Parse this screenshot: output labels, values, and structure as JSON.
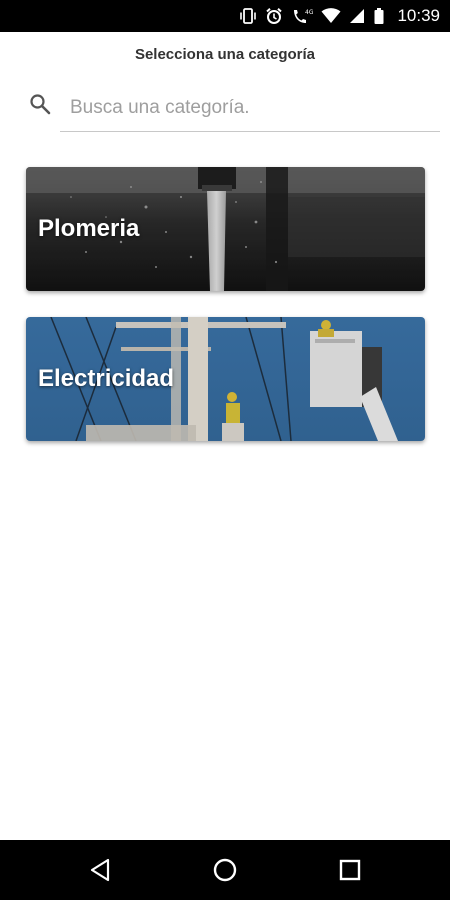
{
  "status_bar": {
    "time": "10:39",
    "icons": [
      "vibrate-icon",
      "alarm-icon",
      "lte-call-icon",
      "wifi-icon",
      "signal-icon",
      "battery-icon"
    ],
    "lte_label": "4G"
  },
  "header": {
    "title": "Selecciona una categoría"
  },
  "search": {
    "placeholder": "Busca una categoría.",
    "value": ""
  },
  "categories": [
    {
      "label": "Plomeria",
      "image": "faucet-water-photo"
    },
    {
      "label": "Electricidad",
      "image": "power-line-workers-photo"
    }
  ],
  "nav_bar": {
    "buttons": [
      "back-icon",
      "home-icon",
      "recents-icon"
    ]
  },
  "colors": {
    "status_bar_bg": "#000000",
    "title_text": "#333333",
    "placeholder_text": "#9e9e9e",
    "divider": "#c8c8c8",
    "electricidad_sky": "#3a72a8"
  }
}
